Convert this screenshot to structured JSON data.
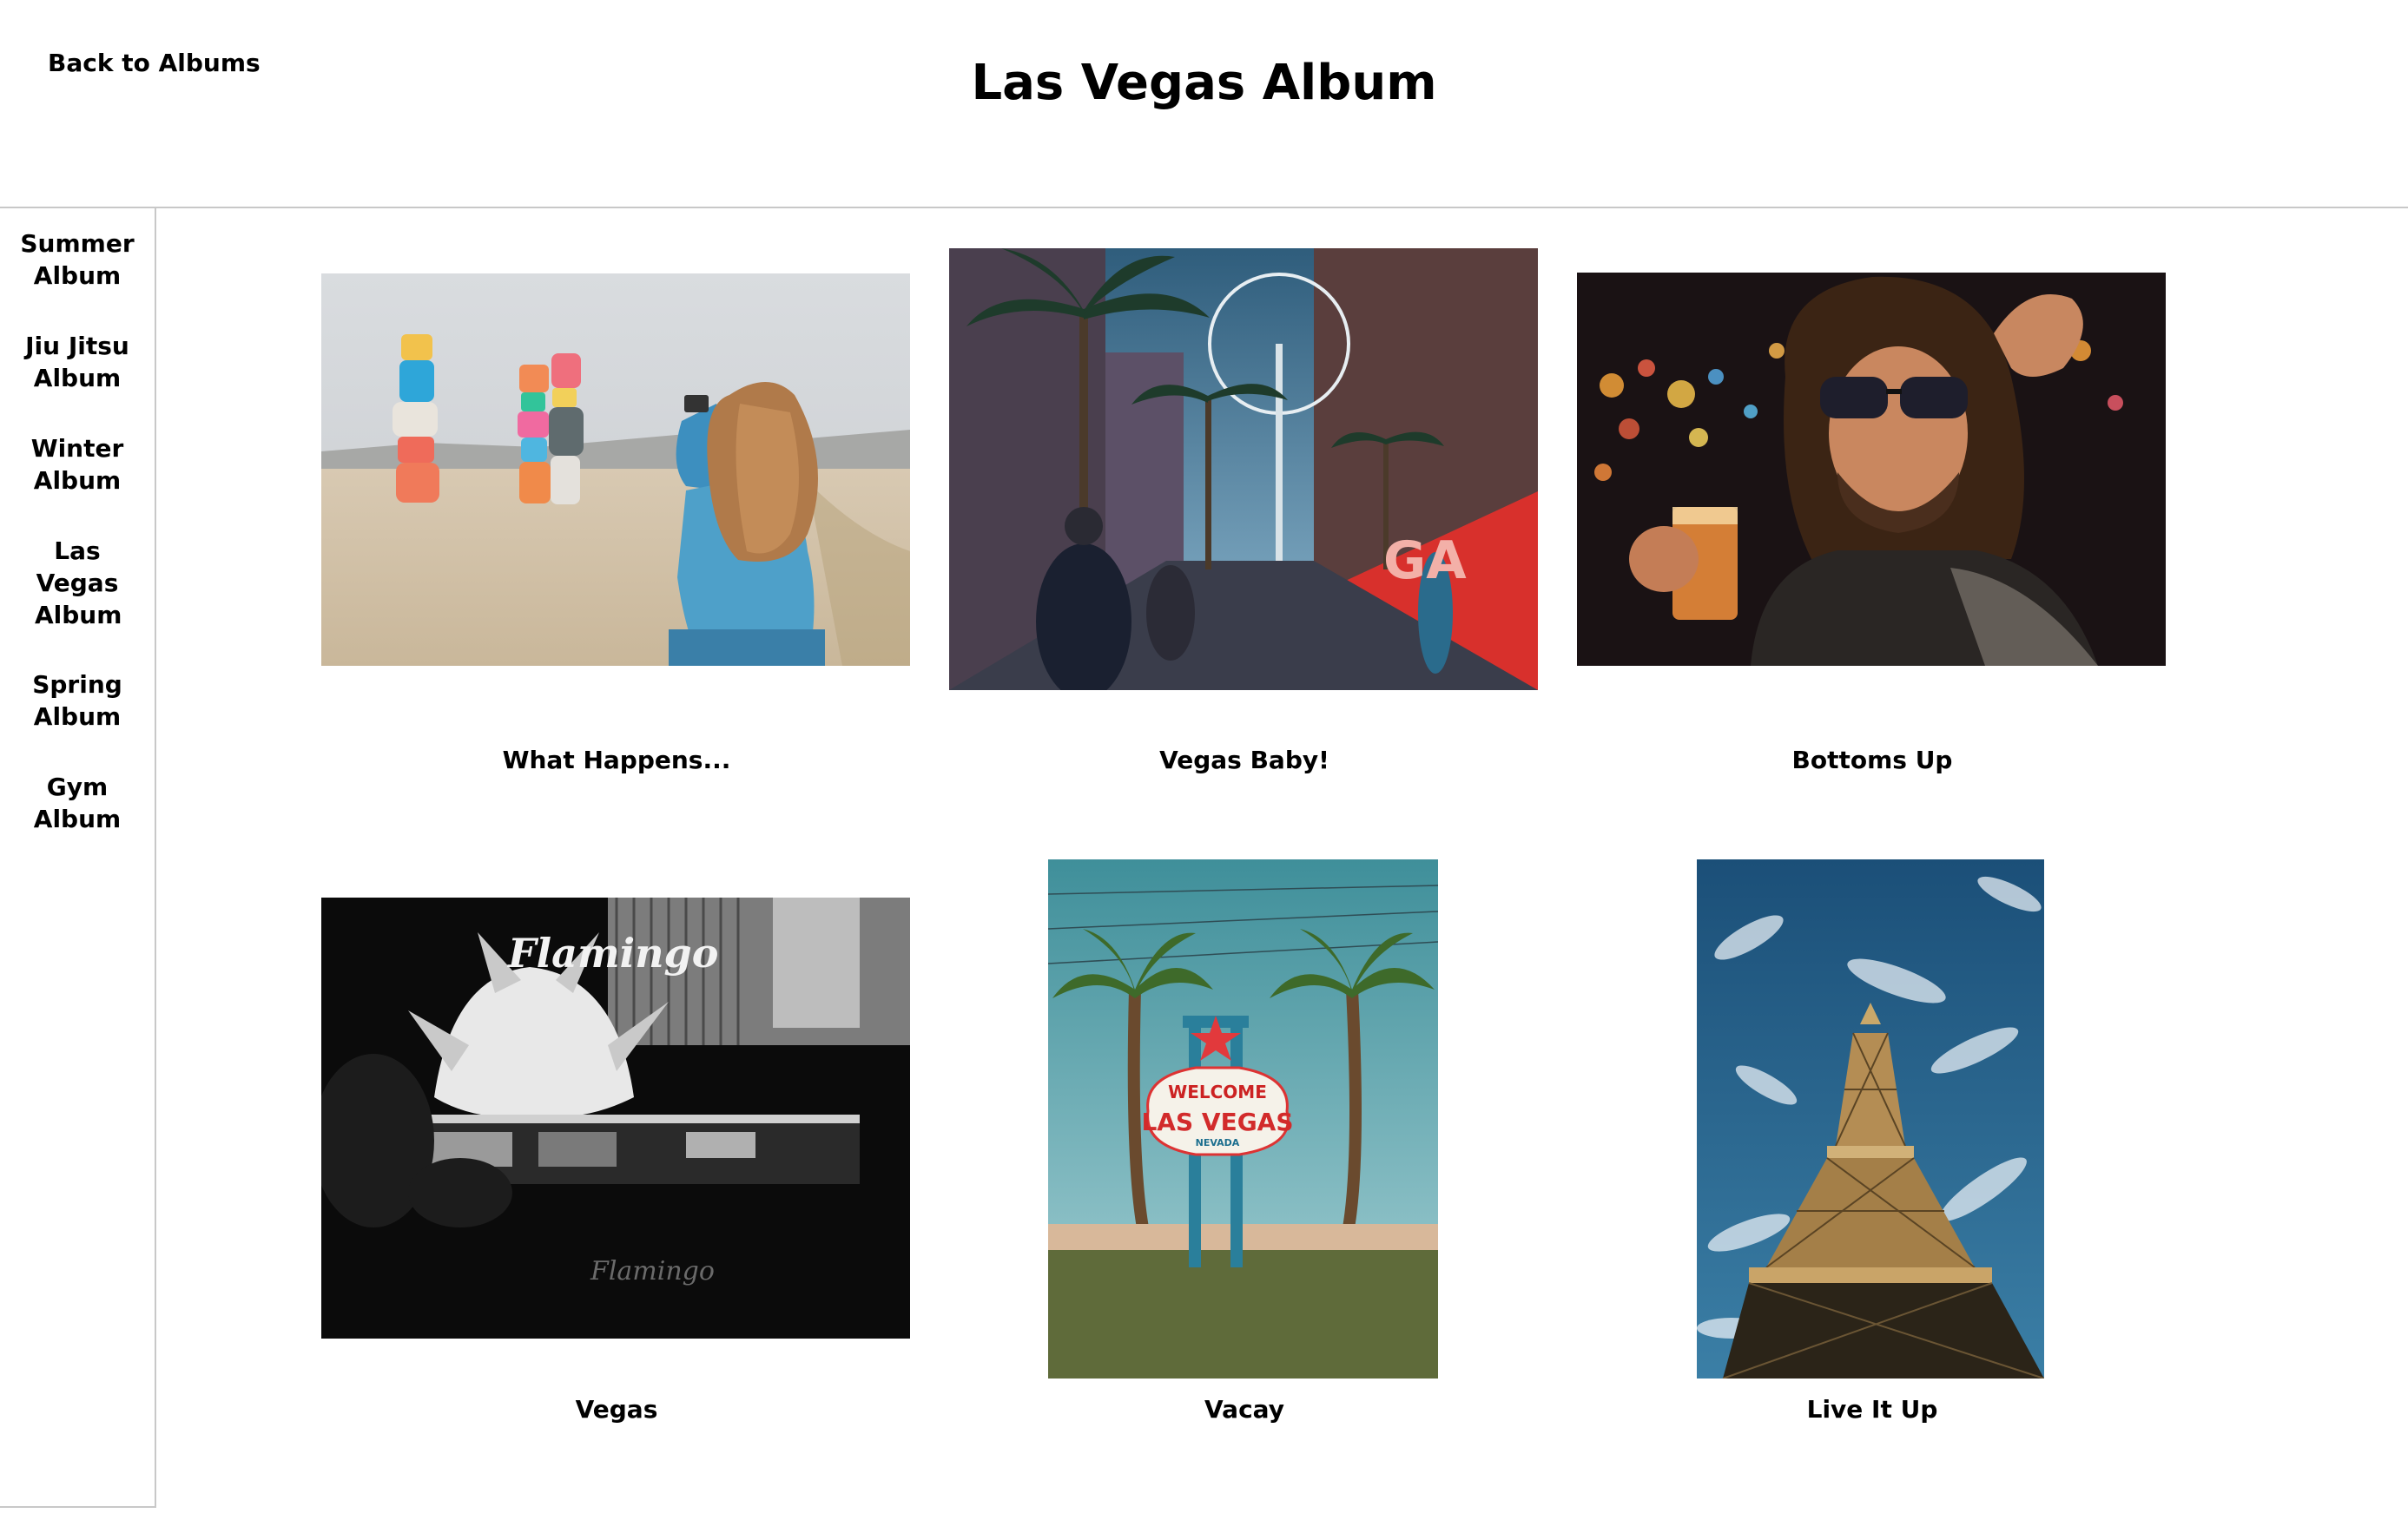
{
  "header": {
    "back_label": "Back to Albums",
    "title": "Las Vegas Album"
  },
  "sidebar": {
    "items": [
      {
        "label": "Summer Album"
      },
      {
        "label": "Jiu Jitsu Album"
      },
      {
        "label": "Winter Album"
      },
      {
        "label": "Las Vegas Album"
      },
      {
        "label": "Spring Album"
      },
      {
        "label": "Gym Album"
      }
    ]
  },
  "gallery": {
    "photos": [
      {
        "caption": "What Happens...",
        "icon": "desert-rock-towers-photo"
      },
      {
        "caption": "Vegas Baby!",
        "icon": "strip-palm-street-photo"
      },
      {
        "caption": "Bottoms Up",
        "icon": "bar-toast-photo"
      },
      {
        "caption": "Vegas",
        "icon": "flamingo-sign-photo"
      },
      {
        "caption": "Vacay",
        "icon": "welcome-sign-photo"
      },
      {
        "caption": "Live It Up",
        "icon": "eiffel-tower-photo"
      }
    ]
  },
  "colors": {
    "divider": "#c8c8c8",
    "text": "#000000",
    "background": "#ffffff"
  }
}
